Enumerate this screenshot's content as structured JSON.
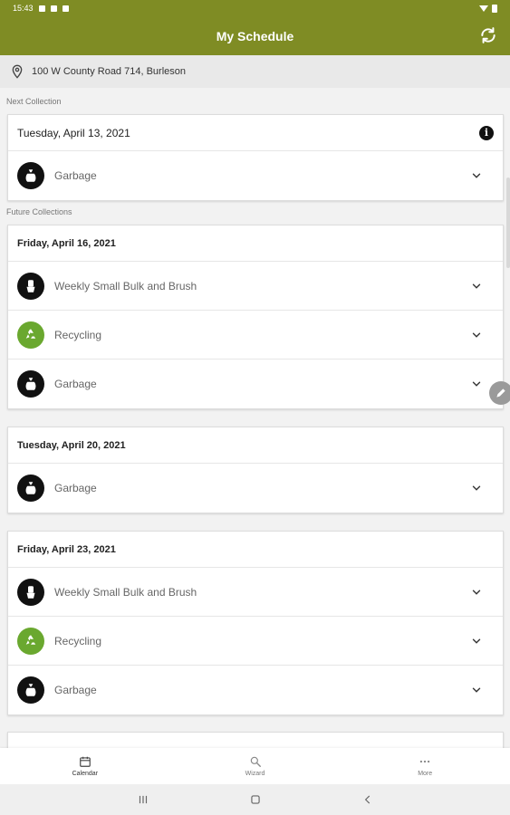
{
  "status_bar": {
    "time": "15:43"
  },
  "app_bar": {
    "title": "My Schedule",
    "refresh_icon": "refresh-icon"
  },
  "address": {
    "text": "100 W County Road 714, Burleson",
    "icon": "location-pin-icon"
  },
  "next_collection": {
    "label": "Next Collection",
    "date": "Tuesday, April 13, 2021",
    "items": [
      {
        "name": "Garbage",
        "icon": "garbage-bag-icon"
      }
    ]
  },
  "future_collections": {
    "label": "Future Collections",
    "cards": [
      {
        "date": "Friday, April 16, 2021",
        "items": [
          {
            "name": "Weekly Small Bulk and Brush",
            "icon": "bulk-brush-icon"
          },
          {
            "name": "Recycling",
            "icon": "recycling-icon"
          },
          {
            "name": "Garbage",
            "icon": "garbage-bag-icon"
          }
        ]
      },
      {
        "date": "Tuesday, April 20, 2021",
        "items": [
          {
            "name": "Garbage",
            "icon": "garbage-bag-icon"
          }
        ]
      },
      {
        "date": "Friday, April 23, 2021",
        "items": [
          {
            "name": "Weekly Small Bulk and Brush",
            "icon": "bulk-brush-icon"
          },
          {
            "name": "Recycling",
            "icon": "recycling-icon"
          },
          {
            "name": "Garbage",
            "icon": "garbage-bag-icon"
          }
        ]
      }
    ]
  },
  "bottom_nav": [
    {
      "label": "Calendar",
      "icon": "calendar-icon",
      "active": true
    },
    {
      "label": "Wizard",
      "icon": "search-icon",
      "active": false
    },
    {
      "label": "More",
      "icon": "more-icon",
      "active": false
    }
  ],
  "colors": {
    "brand": "#7f8c24",
    "recycling": "#6aa82f"
  }
}
